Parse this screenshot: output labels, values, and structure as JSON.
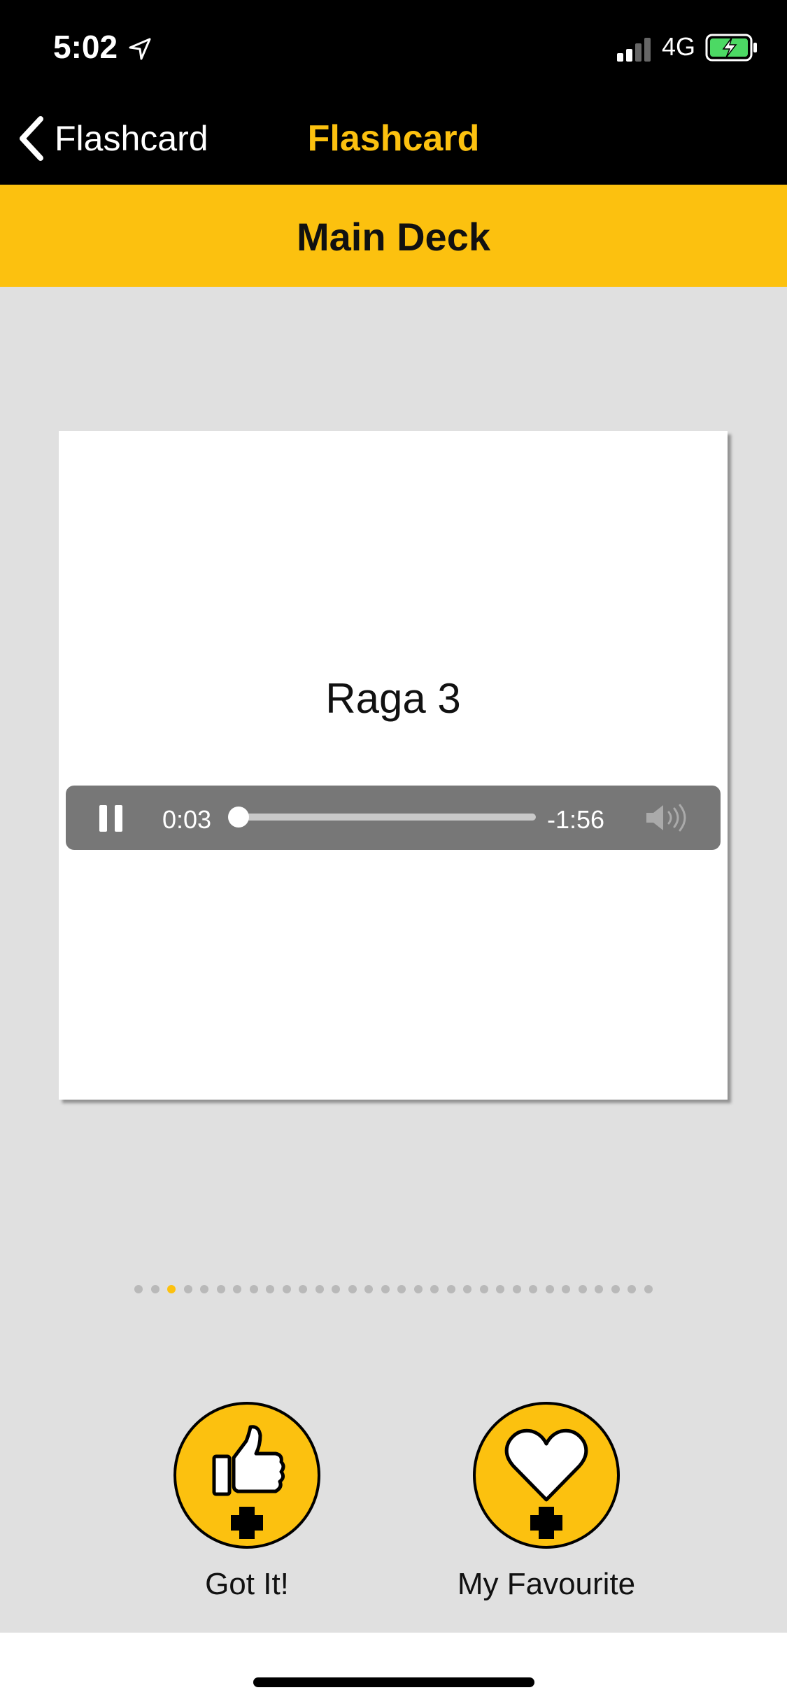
{
  "status_bar": {
    "time": "5:02",
    "network": "4G"
  },
  "nav": {
    "back_label": "Flashcard",
    "title": "Flashcard"
  },
  "deck": {
    "title": "Main Deck"
  },
  "card": {
    "title": "Raga 3",
    "player": {
      "elapsed": "0:03",
      "remaining": "-1:56",
      "progress": 0.025
    }
  },
  "pager": {
    "total": 32,
    "active_index": 2
  },
  "actions": {
    "got_it_label": "Got It!",
    "favourite_label": "My Favourite"
  },
  "colors": {
    "accent": "#fcc10f",
    "bar": "#000000",
    "background": "#e0e0e0"
  },
  "icons": [
    "location-arrow-icon",
    "signal-icon",
    "battery-charging-icon",
    "back-chevron-icon",
    "pause-icon",
    "volume-icon",
    "thumbs-up-plus-icon",
    "heart-plus-icon"
  ]
}
